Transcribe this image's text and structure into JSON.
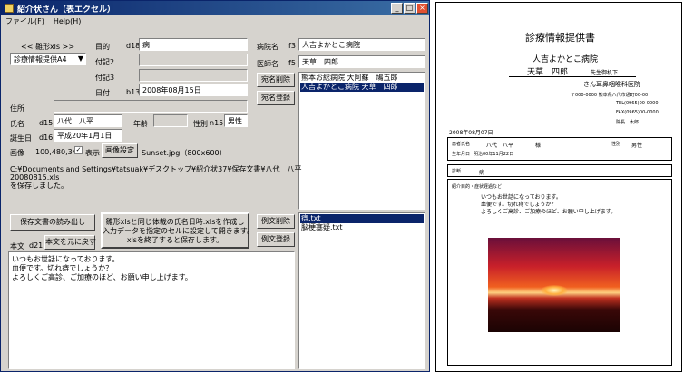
{
  "window": {
    "title": "紹介状さん（表エクセル）",
    "menu": [
      "ファイル(F)",
      "Help(H)"
    ],
    "controls": [
      "_",
      "□",
      "×"
    ]
  },
  "form": {
    "template_label": "<< 雛形xls >>",
    "template_value": "診療情報提供A4",
    "mokuteki_label": "目的",
    "mokuteki_code": "d18",
    "mokuteki_value": "病",
    "tsuki2_label": "付記2",
    "tsuki3_label": "付記3",
    "date_label": "日付",
    "date_code": "b13",
    "date_value": "2008年08月15日",
    "hospital_label": "病院名",
    "hospital_code": "f3",
    "hospital_value": "人吉よかとこ病院",
    "doctor_label": "医師名",
    "doctor_code": "f5",
    "doctor_value": "天草　四郎",
    "delete_dest_btn": "宛名削除",
    "register_dest_btn": "宛名登録",
    "address_label": "住所",
    "name_label": "氏名",
    "name_code": "d15",
    "name_value": "八代　八平",
    "age_label": "年齢",
    "sex_label": "性別",
    "sex_code": "n15",
    "sex_value": "男性",
    "birth_label": "誕生日",
    "birth_code": "d16",
    "birth_value": "平成20年1月1日",
    "image_label": "画像",
    "image_size": "100,480,340",
    "show_label": "表示",
    "image_setting_btn": "画像設定",
    "image_file": "Sunset.jpg（800x600）",
    "status_lines": [
      "C:¥Documents and Settings¥tatsuak¥デスクトップ¥紹介状37¥保存文書¥八代　八平",
      "20080815.xls",
      "を保存しました。"
    ],
    "load_saved_btn": "保存文書の読み出し",
    "main_action_btn": [
      "雛形xlsと同じ体裁の氏名日時.xlsを作成し",
      "入力データを指定のセルに設定して開きます。",
      "xlsを終了すると保存します。"
    ],
    "delete_example_btn": "例文削除",
    "register_example_btn": "例文登録",
    "body_label": "本文",
    "body_code": "d21",
    "restore_body_btn": "本文を元に戻す",
    "body_text": [
      "いつもお世話になっております。",
      "血便です。切れ痔でしょうか？",
      "よろしくご高診、ご加療のほど、お願い申し上げます。"
    ],
    "dest_list": [
      "熊本お総病院 大阿蘇　鳩五郎",
      "人吉よかとこ病院 天草　四郎"
    ],
    "example_list": [
      "痔.txt",
      "脳梗塞疑.txt"
    ]
  },
  "document": {
    "title": "診療情報提供書",
    "to_hospital": "人吉よかとこ病院",
    "to_doctor": "天草　四郎",
    "to_suffix": "先生御机下",
    "from_clinic": "さん耳鼻咽喉科医院",
    "from_lines": [
      "〒000-0000 熊本県八代市通町00-00",
      "TEL(0965)00-0000",
      "FAX(0965)00-0000",
      "院長　太郎"
    ],
    "date": "2008年08月07日",
    "patient_label": "患者氏名",
    "patient_name": "八代　八平",
    "patient_suffix": "様",
    "sex_label": "性別",
    "sex_value": "男性",
    "birth_label": "生年月日",
    "birth_value": "明治00年11月22日",
    "disease_label": "診断",
    "disease_value": "病",
    "purpose_label": "紹介目的・症状経過など",
    "body": [
      "いつもお世話になっております。",
      "血便です。切れ痔でしょうか？",
      "よろしくご高診、ご加療のほど、お願い申し上げます。"
    ]
  }
}
